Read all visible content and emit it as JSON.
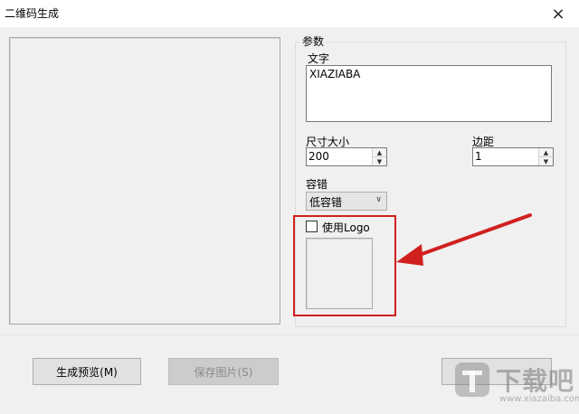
{
  "window": {
    "title": "二维码生成",
    "close_icon": "×"
  },
  "params": {
    "group_label": "参数",
    "text_label": "文字",
    "text_value": "XIAZIABA",
    "size_label": "尺寸大小",
    "size_value": "200",
    "margin_label": "边距",
    "margin_value": "1",
    "error_label": "容错",
    "error_value": "低容错",
    "use_logo_label": "使用Logo"
  },
  "footer": {
    "preview_button": "生成预览(M)",
    "save_button": "保存图片(S)"
  },
  "watermark": {
    "text": "下载吧",
    "url": "www.xiazaiba.com"
  },
  "colors": {
    "highlight": "#d0201e",
    "arrow": "#d0201e"
  }
}
